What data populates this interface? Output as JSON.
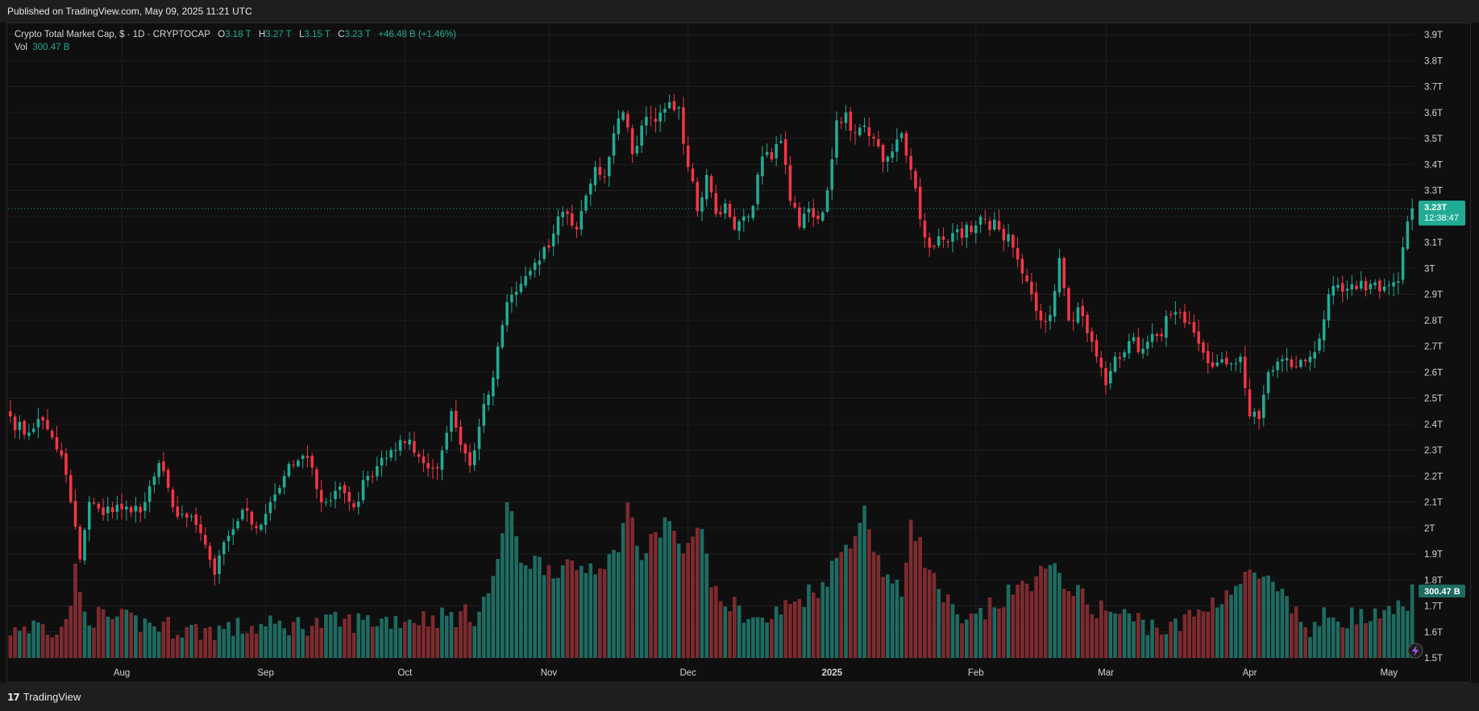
{
  "header": {
    "published": "Published on TradingView.com, May 09, 2025 11:21 UTC"
  },
  "footer": {
    "brand": "TradingView",
    "logo": "tradingview-logo"
  },
  "legend": {
    "symbol": "Crypto Total Market Cap, $ · 1D · CRYPTOCAP",
    "o_label": "O",
    "o_value": "3.18 T",
    "h_label": "H",
    "h_value": "3.27 T",
    "l_label": "L",
    "l_value": "3.15 T",
    "c_label": "C",
    "c_value": "3.23 T",
    "change": "+46.48 B (+1.46%)",
    "vol_label": "Vol",
    "vol_value": "300.47 B"
  },
  "price_tag": {
    "value": "3.23T",
    "countdown": "12:38:47"
  },
  "vol_tag": "300.47 B",
  "colors": {
    "up": "#22ab94",
    "down": "#f23645",
    "vol_up": "#1e6b62",
    "vol_down": "#7d2b2f",
    "background": "#0f0f0f",
    "grid": "#1f1f1f"
  },
  "chart_data": {
    "type": "candlestick",
    "interval": "1D",
    "units": "USD trillions",
    "y_ticks": [
      "1.5T",
      "1.6T",
      "1.7T",
      "1.8T",
      "1.9T",
      "2T",
      "2.1T",
      "2.2T",
      "2.3T",
      "2.4T",
      "2.5T",
      "2.6T",
      "2.7T",
      "2.8T",
      "2.9T",
      "3T",
      "3.1T",
      "3.2T",
      "3.3T",
      "3.4T",
      "3.5T",
      "3.6T",
      "3.7T",
      "3.8T",
      "3.9T"
    ],
    "ylim": [
      1.5,
      3.9
    ],
    "x_ticks": [
      {
        "label": "Aug",
        "day": 24,
        "bold": false
      },
      {
        "label": "Sep",
        "day": 55,
        "bold": false
      },
      {
        "label": "Oct",
        "day": 85,
        "bold": false
      },
      {
        "label": "Nov",
        "day": 116,
        "bold": false
      },
      {
        "label": "Dec",
        "day": 146,
        "bold": false
      },
      {
        "label": "2025",
        "day": 177,
        "bold": true
      },
      {
        "label": "Feb",
        "day": 208,
        "bold": false
      },
      {
        "label": "Mar",
        "day": 236,
        "bold": false
      },
      {
        "label": "Apr",
        "day": 267,
        "bold": false
      },
      {
        "label": "May",
        "day": 297,
        "bold": false
      }
    ],
    "close_anchors": [
      [
        0,
        2.43
      ],
      [
        3,
        2.36
      ],
      [
        6,
        2.42
      ],
      [
        8,
        2.38
      ],
      [
        11,
        2.28
      ],
      [
        13,
        2.1
      ],
      [
        15,
        1.88
      ],
      [
        17,
        2.1
      ],
      [
        20,
        2.05
      ],
      [
        23,
        2.09
      ],
      [
        26,
        2.06
      ],
      [
        29,
        2.1
      ],
      [
        32,
        2.25
      ],
      [
        35,
        2.08
      ],
      [
        38,
        2.04
      ],
      [
        41,
        1.98
      ],
      [
        44,
        1.82
      ],
      [
        47,
        1.97
      ],
      [
        50,
        2.07
      ],
      [
        53,
        2
      ],
      [
        56,
        2.1
      ],
      [
        59,
        2.2
      ],
      [
        62,
        2.26
      ],
      [
        64,
        2.27
      ],
      [
        66,
        2.15
      ],
      [
        68,
        2.1
      ],
      [
        71,
        2.16
      ],
      [
        74,
        2.08
      ],
      [
        77,
        2.2
      ],
      [
        80,
        2.27
      ],
      [
        83,
        2.3
      ],
      [
        86,
        2.34
      ],
      [
        89,
        2.25
      ],
      [
        92,
        2.23
      ],
      [
        95,
        2.45
      ],
      [
        97,
        2.32
      ],
      [
        99,
        2.24
      ],
      [
        101,
        2.39
      ],
      [
        104,
        2.58
      ],
      [
        107,
        2.87
      ],
      [
        109,
        2.91
      ],
      [
        111,
        2.97
      ],
      [
        114,
        3.03
      ],
      [
        116,
        3.08
      ],
      [
        118,
        3.2
      ],
      [
        120,
        3.21
      ],
      [
        122,
        3.15
      ],
      [
        124,
        3.28
      ],
      [
        126,
        3.39
      ],
      [
        128,
        3.35
      ],
      [
        130,
        3.52
      ],
      [
        132,
        3.6
      ],
      [
        134,
        3.44
      ],
      [
        136,
        3.55
      ],
      [
        138,
        3.58
      ],
      [
        140,
        3.6
      ],
      [
        142,
        3.64
      ],
      [
        144,
        3.62
      ],
      [
        146,
        3.39
      ],
      [
        148,
        3.22
      ],
      [
        150,
        3.36
      ],
      [
        152,
        3.21
      ],
      [
        154,
        3.25
      ],
      [
        156,
        3.15
      ],
      [
        158,
        3.2
      ],
      [
        160,
        3.24
      ],
      [
        162,
        3.43
      ],
      [
        164,
        3.42
      ],
      [
        166,
        3.49
      ],
      [
        168,
        3.26
      ],
      [
        170,
        3.16
      ],
      [
        172,
        3.23
      ],
      [
        174,
        3.19
      ],
      [
        176,
        3.3
      ],
      [
        178,
        3.57
      ],
      [
        180,
        3.6
      ],
      [
        182,
        3.52
      ],
      [
        184,
        3.55
      ],
      [
        186,
        3.5
      ],
      [
        188,
        3.41
      ],
      [
        190,
        3.45
      ],
      [
        192,
        3.52
      ],
      [
        194,
        3.38
      ],
      [
        196,
        3.19
      ],
      [
        198,
        3.08
      ],
      [
        201,
        3.11
      ],
      [
        204,
        3.15
      ],
      [
        207,
        3.14
      ],
      [
        210,
        3.19
      ],
      [
        213,
        3.15
      ],
      [
        216,
        3.08
      ],
      [
        218,
        2.98
      ],
      [
        220,
        2.9
      ],
      [
        222,
        2.8
      ],
      [
        224,
        2.82
      ],
      [
        226,
        3.04
      ],
      [
        228,
        2.8
      ],
      [
        230,
        2.85
      ],
      [
        232,
        2.75
      ],
      [
        234,
        2.66
      ],
      [
        236,
        2.55
      ],
      [
        238,
        2.66
      ],
      [
        241,
        2.72
      ],
      [
        244,
        2.69
      ],
      [
        247,
        2.74
      ],
      [
        250,
        2.82
      ],
      [
        253,
        2.79
      ],
      [
        256,
        2.71
      ],
      [
        259,
        2.62
      ],
      [
        262,
        2.63
      ],
      [
        265,
        2.66
      ],
      [
        267,
        2.43
      ],
      [
        269,
        2.42
      ],
      [
        271,
        2.6
      ],
      [
        274,
        2.65
      ],
      [
        277,
        2.62
      ],
      [
        280,
        2.66
      ],
      [
        282,
        2.73
      ],
      [
        284,
        2.9
      ],
      [
        287,
        2.91
      ],
      [
        290,
        2.92
      ],
      [
        293,
        2.94
      ],
      [
        296,
        2.93
      ],
      [
        299,
        2.95
      ],
      [
        301,
        3.18
      ],
      [
        302,
        3.23
      ]
    ],
    "approx_volume_anchors": [
      [
        0,
        1.63
      ],
      [
        12,
        1.64
      ],
      [
        14,
        1.84
      ],
      [
        16,
        1.68
      ],
      [
        40,
        1.62
      ],
      [
        70,
        1.65
      ],
      [
        100,
        1.68
      ],
      [
        104,
        1.8
      ],
      [
        107,
        2.11
      ],
      [
        110,
        1.9
      ],
      [
        120,
        1.85
      ],
      [
        130,
        1.9
      ],
      [
        133,
        2.1
      ],
      [
        136,
        1.9
      ],
      [
        142,
        2.06
      ],
      [
        145,
        1.88
      ],
      [
        148,
        2.06
      ],
      [
        152,
        1.75
      ],
      [
        162,
        1.65
      ],
      [
        175,
        1.8
      ],
      [
        184,
        2.07
      ],
      [
        188,
        1.85
      ],
      [
        192,
        1.75
      ],
      [
        194,
        2.06
      ],
      [
        198,
        1.84
      ],
      [
        205,
        1.63
      ],
      [
        222,
        1.84
      ],
      [
        226,
        1.84
      ],
      [
        232,
        1.72
      ],
      [
        250,
        1.62
      ],
      [
        268,
        1.84
      ],
      [
        270,
        1.82
      ],
      [
        280,
        1.62
      ],
      [
        284,
        1.68
      ],
      [
        296,
        1.66
      ],
      [
        300,
        1.72
      ],
      [
        302,
        1.76
      ]
    ],
    "last_close": 3.23
  }
}
